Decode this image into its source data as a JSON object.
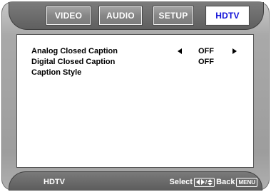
{
  "tabs": [
    {
      "label": "VIDEO",
      "active": false
    },
    {
      "label": "AUDIO",
      "active": false
    },
    {
      "label": "SETUP",
      "active": false
    },
    {
      "label": "HDTV",
      "active": true
    }
  ],
  "menu": {
    "items": [
      {
        "label": "Analog Closed Caption",
        "value": "OFF",
        "has_arrows": true
      },
      {
        "label": "Digital Closed Caption",
        "value": "OFF",
        "has_arrows": false
      },
      {
        "label": "Caption Style",
        "value": "",
        "has_arrows": false
      }
    ]
  },
  "status": {
    "title": "HDTV",
    "select_label": "Select",
    "back_label": "Back",
    "menu_key": "MENU",
    "nav_key_icons": [
      "left-right-arrow-icon",
      "up-down-arrow-icon"
    ],
    "nav_key_separator": "/"
  },
  "colors": {
    "active_tab_text": "#1010d8",
    "active_tab_bg": "#ffffff",
    "bar_bg": "#666666",
    "bezel": "#a9a9a9"
  }
}
